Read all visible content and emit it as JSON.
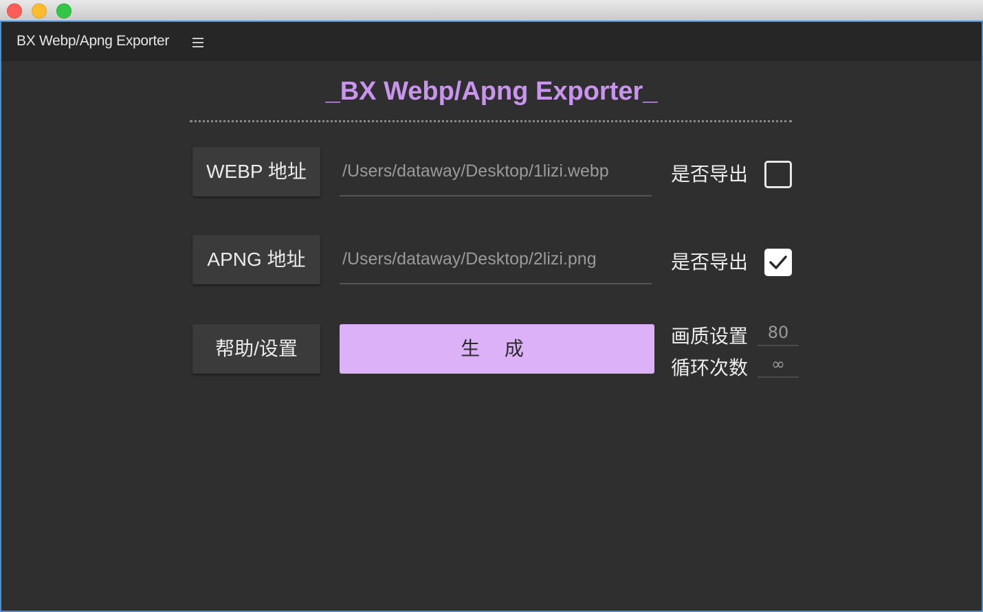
{
  "window": {
    "controls": [
      "close",
      "minimize",
      "zoom"
    ]
  },
  "panel": {
    "title": "BX Webp/Apng Exporter",
    "menu_icon": "hamburger-menu-icon"
  },
  "main": {
    "title": "_BX Webp/Apng Exporter_"
  },
  "webp": {
    "button_label": "WEBP 地址",
    "path_value": "/Users/dataway/Desktop/1lizi.webp",
    "export_label": "是否导出",
    "export_checked": false
  },
  "apng": {
    "button_label": "APNG 地址",
    "path_value": "/Users/dataway/Desktop/2lizi.png",
    "export_label": "是否导出",
    "export_checked": true
  },
  "actions": {
    "help_label": "帮助/设置",
    "generate_label": "生 成"
  },
  "settings": {
    "quality_label": "画质设置",
    "quality_value": "80",
    "loop_label": "循环次数",
    "loop_value": "∞"
  },
  "colors": {
    "accent": "#c994ee",
    "generate_bg": "#dcb1f7",
    "background": "#2f2f2f",
    "header_bg": "#262626",
    "window_border": "#4a90d9"
  }
}
